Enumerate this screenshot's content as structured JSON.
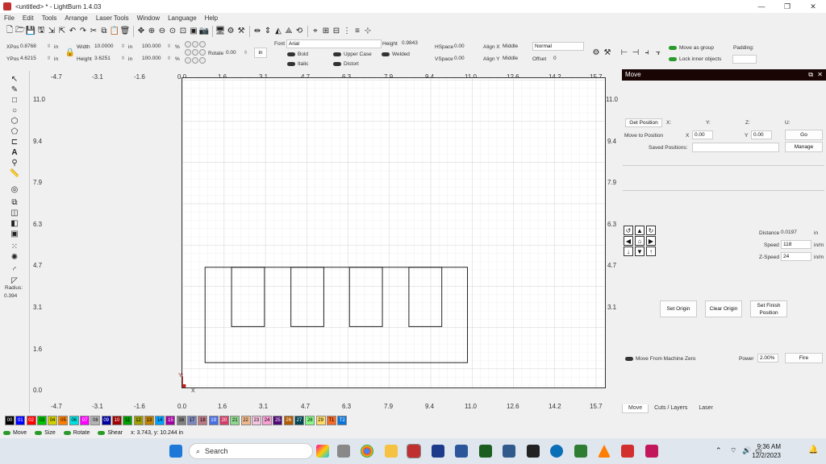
{
  "window": {
    "title": "<untitled> * - LightBurn 1.4.03",
    "controls": [
      "—",
      "❐",
      "✕"
    ]
  },
  "menu": [
    "File",
    "Edit",
    "Tools",
    "Arrange",
    "Laser Tools",
    "Window",
    "Language",
    "Help"
  ],
  "toolbar2": {
    "xpos_label": "XPos",
    "xpos": "0.8768",
    "ypos_label": "YPos",
    "ypos": "4.6215",
    "unit": "in",
    "width_label": "Width",
    "width": "10.0000",
    "height_label": "Height",
    "height": "3.6251",
    "scale_w": "100.000",
    "scale_h": "100.000",
    "pct": "%",
    "rotate_label": "Rotate",
    "rotate": "0.00",
    "unit_btn": "in",
    "font_label": "Font",
    "font": "Arial",
    "bold": "Bold",
    "italic": "Italic",
    "upper_case": "Upper Case",
    "welded": "Welded",
    "distort": "Distort",
    "text_height_label": "Height",
    "text_height": "0.9843",
    "hspace_label": "HSpace",
    "hspace": "0.00",
    "vspace_label": "VSpace",
    "vspace": "0.00",
    "alignx_label": "Align X",
    "alignx": "Middle",
    "aligny_label": "Align Y",
    "aligny": "Middle",
    "normal": "Normal",
    "offset_label": "Offset",
    "offset": "0",
    "move_as_group": "Move as group",
    "lock_inner": "Lock inner objects",
    "padding": "Padding:"
  },
  "left_tools": {
    "radius_label": "Radius:",
    "radius": "0.394"
  },
  "ruler_x": [
    "-4.7",
    "-3.1",
    "-1.6",
    "0.0",
    "1.6",
    "3.1",
    "4.7",
    "6.3",
    "7.9",
    "9.4",
    "11.0",
    "12.6",
    "14.2",
    "15.7"
  ],
  "ruler_y": [
    "11.0",
    "9.4",
    "7.9",
    "6.3",
    "4.7",
    "3.1",
    "1.6",
    "0.0"
  ],
  "canvas_axis": {
    "x": "X",
    "y": "Y"
  },
  "move_panel": {
    "title": "Move",
    "get_position": "Get Position",
    "x_label": "X:",
    "y_label": "Y:",
    "z_label": "Z:",
    "u_label": "U:",
    "move_to_position": "Move to Position",
    "mx_label": "X",
    "mx": "0.00",
    "my_label": "Y",
    "my": "0.00",
    "go": "Go",
    "saved_positions": "Saved Positions:",
    "manage": "Manage",
    "distance_label": "Distance",
    "distance": "0.0197",
    "distance_unit": "in",
    "speed_label": "Speed",
    "speed": "118",
    "speed_unit": "in/m",
    "zspeed_label": "Z-Speed",
    "zspeed": "24",
    "zspeed_unit": "in/m",
    "set_origin": "Set Origin",
    "clear_origin": "Clear Origin",
    "set_finish": "Set Finish Position",
    "move_from_zero": "Move From Machine Zero",
    "power_label": "Power",
    "power": "2.00%",
    "fire": "Fire"
  },
  "tabs": [
    "Move",
    "Cuts / Layers",
    "Laser"
  ],
  "palette": [
    {
      "l": "00",
      "c": "#000000",
      "t": "#ffffff"
    },
    {
      "l": "01",
      "c": "#0000ff",
      "t": "#ffffff"
    },
    {
      "l": "02",
      "c": "#ff0000",
      "t": "#ffffff"
    },
    {
      "l": "03",
      "c": "#00c000",
      "t": "#000000"
    },
    {
      "l": "04",
      "c": "#d0d000",
      "t": "#000000"
    },
    {
      "l": "05",
      "c": "#ff8000",
      "t": "#000000"
    },
    {
      "l": "06",
      "c": "#00e0e0",
      "t": "#000000"
    },
    {
      "l": "07",
      "c": "#ff00ff",
      "t": "#ffffff"
    },
    {
      "l": "08",
      "c": "#b4b4b4",
      "t": "#000000"
    },
    {
      "l": "09",
      "c": "#0000a0",
      "t": "#ffffff"
    },
    {
      "l": "10",
      "c": "#a00000",
      "t": "#ffffff"
    },
    {
      "l": "11",
      "c": "#00a000",
      "t": "#000000"
    },
    {
      "l": "12",
      "c": "#a0a000",
      "t": "#000000"
    },
    {
      "l": "13",
      "c": "#c08000",
      "t": "#000000"
    },
    {
      "l": "14",
      "c": "#00a0ff",
      "t": "#000000"
    },
    {
      "l": "15",
      "c": "#a000a0",
      "t": "#ffffff"
    },
    {
      "l": "16",
      "c": "#808080",
      "t": "#000000"
    },
    {
      "l": "17",
      "c": "#7d87b9",
      "t": "#000000"
    },
    {
      "l": "18",
      "c": "#bb7784",
      "t": "#000000"
    },
    {
      "l": "19",
      "c": "#4a6fe3",
      "t": "#ffffff"
    },
    {
      "l": "20",
      "c": "#d33f6a",
      "t": "#ffffff"
    },
    {
      "l": "21",
      "c": "#8cd78c",
      "t": "#000000"
    },
    {
      "l": "22",
      "c": "#f0b98d",
      "t": "#000000"
    },
    {
      "l": "23",
      "c": "#f6c4e1",
      "t": "#000000"
    },
    {
      "l": "24",
      "c": "#fa9ed4",
      "t": "#000000"
    },
    {
      "l": "25",
      "c": "#500a78",
      "t": "#ffffff"
    },
    {
      "l": "26",
      "c": "#b45a00",
      "t": "#ffffff"
    },
    {
      "l": "27",
      "c": "#004754",
      "t": "#ffffff"
    },
    {
      "l": "28",
      "c": "#86fa88",
      "t": "#000000"
    },
    {
      "l": "29",
      "c": "#ffdb66",
      "t": "#000000"
    },
    {
      "l": "T1",
      "c": "#f36926",
      "t": "#000000"
    },
    {
      "l": "T2",
      "c": "#0c74d6",
      "t": "#ffffff"
    }
  ],
  "status": {
    "move": "Move",
    "size": "Size",
    "rotate": "Rotate",
    "shear": "Shear",
    "coords": "x: 3.743, y: 10.244 in"
  },
  "taskbar": {
    "search": "Search",
    "time": "9:36 AM",
    "date": "12/2/2023"
  }
}
